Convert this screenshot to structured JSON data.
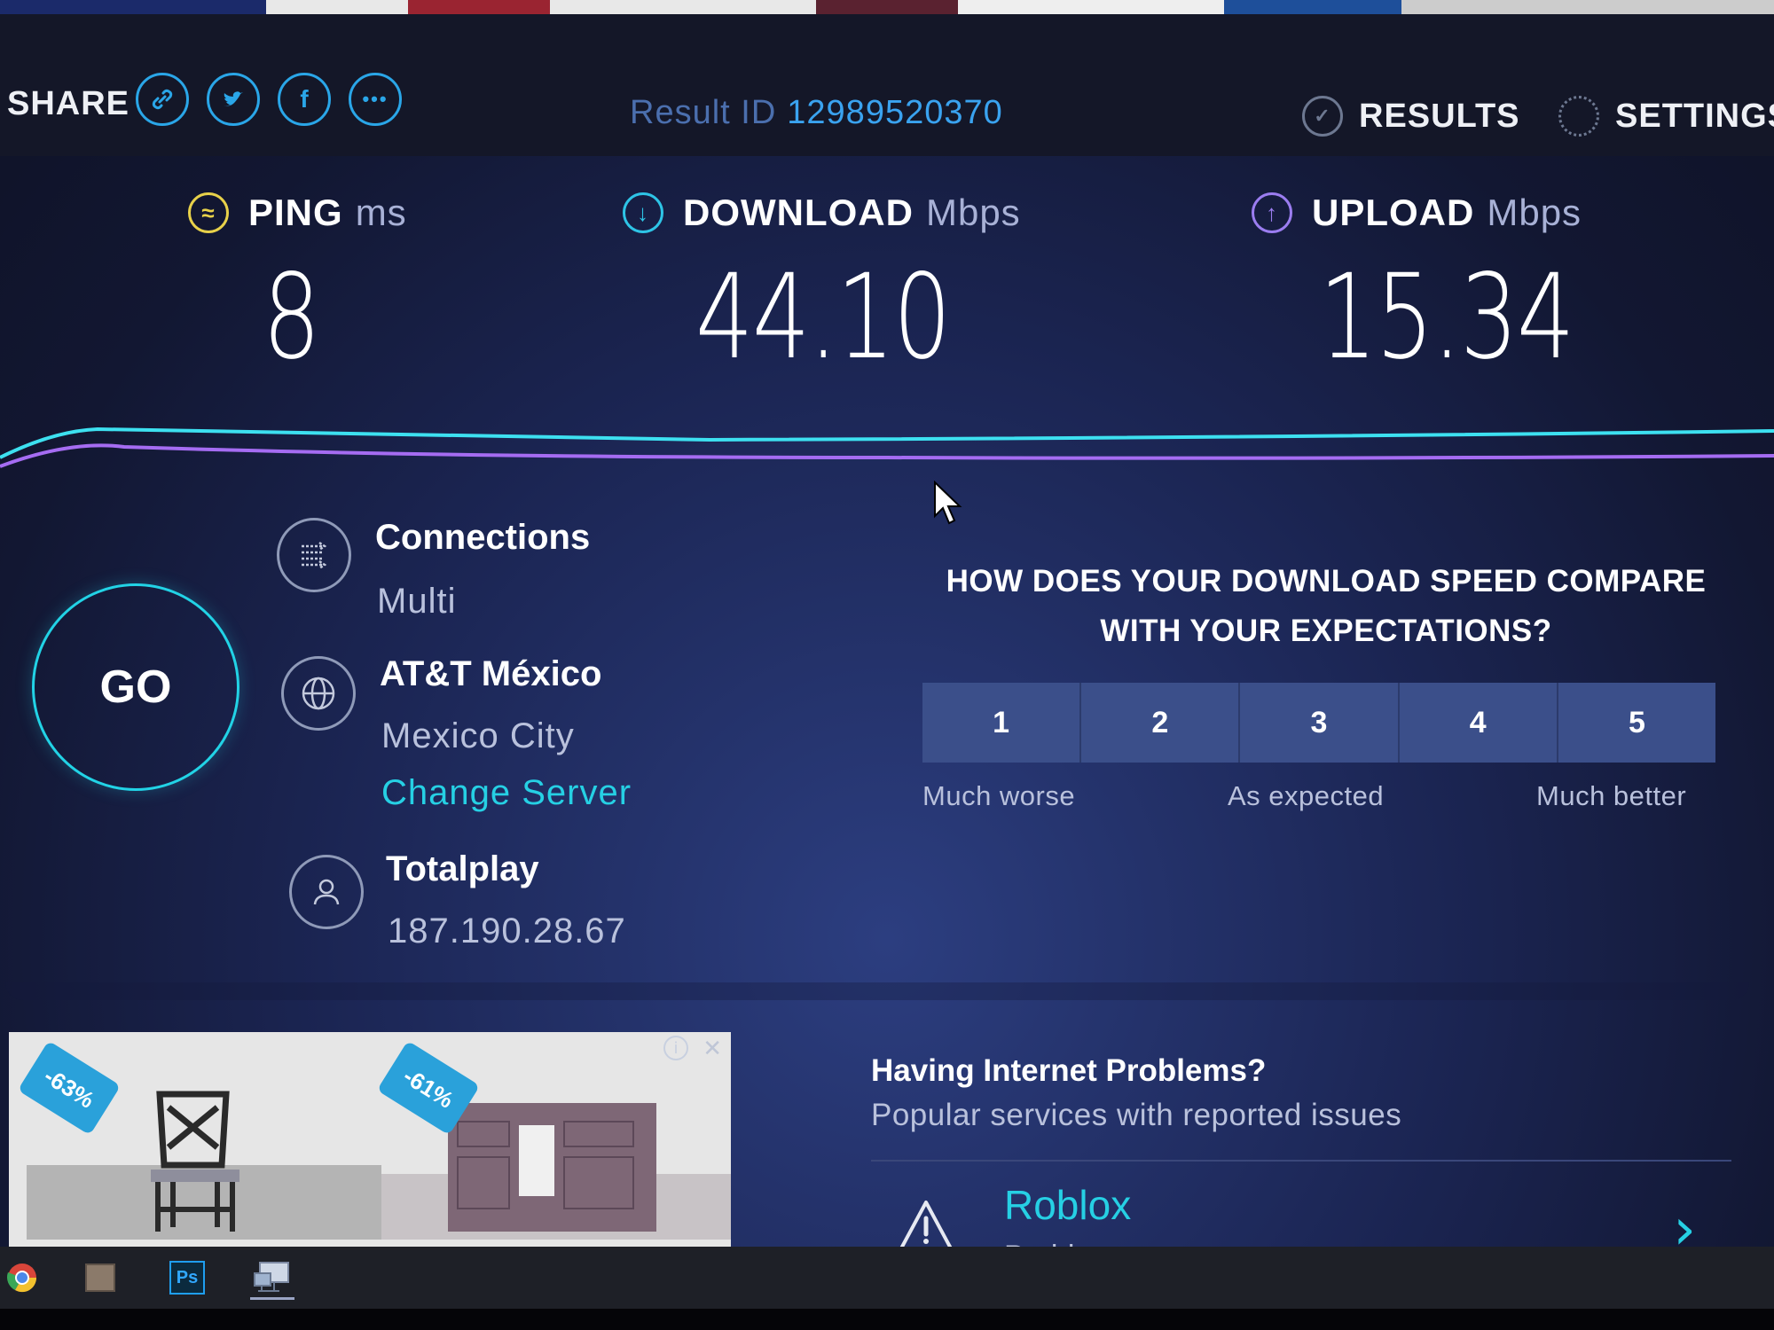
{
  "header": {
    "share_label": "SHARE",
    "share_buttons": [
      {
        "icon": "link-icon"
      },
      {
        "icon": "twitter-icon"
      },
      {
        "icon": "facebook-icon"
      },
      {
        "icon": "more-icon"
      }
    ],
    "result_id_label": "Result ID",
    "result_id_value": "12989520370",
    "results_label": "RESULTS",
    "settings_label": "SETTINGS"
  },
  "metrics": {
    "ping": {
      "label": "PING",
      "unit": "ms",
      "value": "8"
    },
    "download": {
      "label": "DOWNLOAD",
      "unit": "Mbps",
      "value": "44.10"
    },
    "upload": {
      "label": "UPLOAD",
      "unit": "Mbps",
      "value": "15.34"
    }
  },
  "go_label": "GO",
  "connections": {
    "title": "Connections",
    "value": "Multi"
  },
  "server": {
    "name": "AT&T México",
    "location": "Mexico City",
    "change_label": "Change Server"
  },
  "isp": {
    "name": "Totalplay",
    "ip": "187.190.28.67"
  },
  "survey": {
    "question": "HOW DOES YOUR DOWNLOAD SPEED COMPARE WITH YOUR EXPECTATIONS?",
    "ratings": [
      "1",
      "2",
      "3",
      "4",
      "5"
    ],
    "labels": {
      "low": "Much worse",
      "mid": "As expected",
      "high": "Much better"
    }
  },
  "ad": {
    "tag1": "-63%",
    "tag2": "-61%"
  },
  "problems": {
    "title": "Having Internet Problems?",
    "subtitle": "Popular services with reported issues",
    "services": [
      {
        "name": "Roblox",
        "status": "Problems"
      }
    ]
  },
  "taskbar": {
    "ps_label": "Ps"
  },
  "colors": {
    "accent_cyan": "#26d0e4",
    "accent_blue": "#3aa3f0",
    "ping_yellow": "#e8d14a",
    "download_cyan": "#2ec4e6",
    "upload_purple": "#9b7df0",
    "background": "#1b2553"
  }
}
